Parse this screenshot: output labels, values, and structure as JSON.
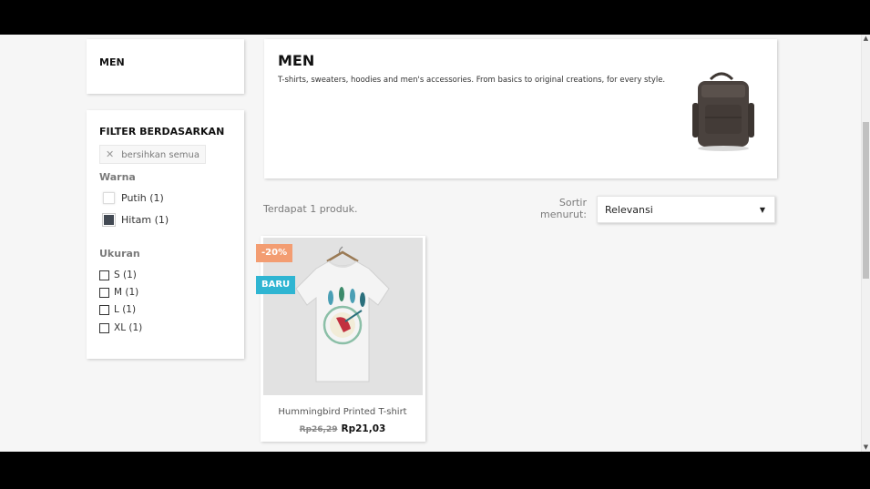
{
  "sidebar": {
    "category_title": "MEN",
    "filter_title": "FILTER BERDASARKAN",
    "clear_all": "bersihkan semua",
    "color_facet": {
      "title": "Warna",
      "options": [
        {
          "label": "Putih (1)",
          "color": "#ffffff"
        },
        {
          "label": "Hitam (1)",
          "color": "#434a54"
        }
      ]
    },
    "size_facet": {
      "title": "Ukuran",
      "options": [
        {
          "label": "S (1)"
        },
        {
          "label": "M (1)"
        },
        {
          "label": "L (1)"
        },
        {
          "label": "XL (1)"
        }
      ]
    }
  },
  "category": {
    "title": "MEN",
    "description": "T-shirts, sweaters, hoodies and men's accessories. From basics to original creations, for every style."
  },
  "listing": {
    "count_text": "Terdapat 1 produk.",
    "sort_label": "Sortir menurut:",
    "sort_value": "Relevansi"
  },
  "product": {
    "name": "Hummingbird Printed T-shirt",
    "old_price": "Rp26,29",
    "price": "Rp21,03",
    "discount_badge": "-20%",
    "new_badge": "BARU"
  },
  "colors": {
    "discount_badge": "#f39d72",
    "new_badge": "#2fb5d2"
  }
}
